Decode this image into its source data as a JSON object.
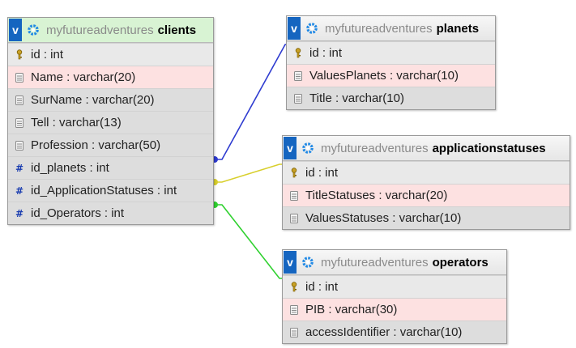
{
  "database": "myfutureadventures",
  "toggle_label": "v",
  "colors": {
    "link_planets": "#2e3bd0",
    "link_applicationstatuses": "#d8cf2c",
    "link_operators": "#2fd12f",
    "header_active": "#d8f3d3",
    "highlight_row": "#fde1e1"
  },
  "tables": {
    "clients": {
      "name": "clients",
      "columns": [
        {
          "label": "id : int",
          "icon": "key-icon"
        },
        {
          "label": "Name : varchar(20)",
          "icon": "column-icon"
        },
        {
          "label": "SurName : varchar(20)",
          "icon": "column-icon"
        },
        {
          "label": "Tell : varchar(13)",
          "icon": "column-icon"
        },
        {
          "label": "Profession : varchar(50)",
          "icon": "column-icon"
        },
        {
          "label": "id_planets : int",
          "icon": "hash-icon"
        },
        {
          "label": "id_ApplicationStatuses : int",
          "icon": "hash-icon"
        },
        {
          "label": "id_Operators : int",
          "icon": "hash-icon"
        }
      ]
    },
    "planets": {
      "name": "planets",
      "columns": [
        {
          "label": "id : int",
          "icon": "key-icon"
        },
        {
          "label": "ValuesPlanets : varchar(10)",
          "icon": "column-icon"
        },
        {
          "label": "Title : varchar(10)",
          "icon": "column-icon"
        }
      ]
    },
    "applicationstatuses": {
      "name": "applicationstatuses",
      "columns": [
        {
          "label": "id : int",
          "icon": "key-icon"
        },
        {
          "label": "TitleStatuses : varchar(20)",
          "icon": "column-icon"
        },
        {
          "label": "ValuesStatuses : varchar(10)",
          "icon": "column-icon"
        }
      ]
    },
    "operators": {
      "name": "operators",
      "columns": [
        {
          "label": "id : int",
          "icon": "key-icon"
        },
        {
          "label": "PIB : varchar(30)",
          "icon": "column-icon"
        },
        {
          "label": "accessIdentifier : varchar(10)",
          "icon": "column-icon"
        }
      ]
    }
  }
}
